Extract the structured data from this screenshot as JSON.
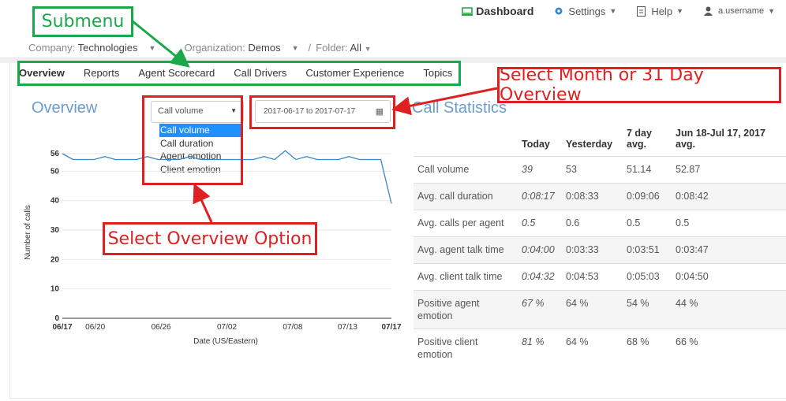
{
  "topnav": {
    "dashboard": "Dashboard",
    "settings": "Settings",
    "help": "Help",
    "user": "a.username"
  },
  "filters": {
    "company_label": "Company:",
    "company_value": "Technologies",
    "org_label": "Organization:",
    "org_value": "Demos",
    "folder_label": "Folder:",
    "folder_value": "All"
  },
  "subnav": {
    "tabs": [
      "Overview",
      "Reports",
      "Agent Scorecard",
      "Call Drivers",
      "Customer Experience",
      "Topics"
    ],
    "active": 0
  },
  "annotations": {
    "submenu": "Submenu",
    "month_overview": "Select Month or 31 Day Overview",
    "overview_option": "Select Overview Option",
    "green": "#1aa84a",
    "red": "#e02020"
  },
  "overview": {
    "title": "Overview",
    "select_value": "Call volume",
    "options": [
      "Call volume",
      "Call duration",
      "Agent emotion",
      "Client emotion"
    ],
    "date_range": "2017-06-17 to 2017-07-17"
  },
  "stats": {
    "title": "Call Statistics",
    "headers": [
      "",
      "Today",
      "Yesterday",
      "7 day avg.",
      "Jun 18-Jul 17, 2017 avg."
    ],
    "rows": [
      [
        "Call volume",
        "39",
        "53",
        "51.14",
        "52.87"
      ],
      [
        "Avg. call duration",
        "0:08:17",
        "0:08:33",
        "0:09:06",
        "0:08:42"
      ],
      [
        "Avg. calls per agent",
        "0.5",
        "0.6",
        "0.5",
        "0.5"
      ],
      [
        "Avg. agent talk time",
        "0:04:00",
        "0:03:33",
        "0:03:51",
        "0:03:47"
      ],
      [
        "Avg. client talk time",
        "0:04:32",
        "0:04:53",
        "0:05:03",
        "0:04:50"
      ],
      [
        "Positive agent emotion",
        "67 %",
        "64 %",
        "54 %",
        "44 %"
      ],
      [
        "Positive client emotion",
        "81 %",
        "64 %",
        "68 %",
        "66 %"
      ]
    ]
  },
  "chart_data": {
    "type": "line",
    "xlabel": "Date (US/Eastern)",
    "ylabel": "Number of calls",
    "x_ticks": [
      "06/17",
      "06/20",
      "06/26",
      "07/02",
      "07/08",
      "07/13",
      "07/17"
    ],
    "y_ticks": [
      0,
      10,
      20,
      30,
      40,
      50,
      56
    ],
    "ylim": [
      0,
      56
    ],
    "color": "#3a87c8",
    "series": [
      {
        "values": [
          56,
          54,
          54,
          54,
          55,
          54,
          54,
          54,
          55,
          54,
          54,
          54,
          55,
          54,
          54,
          54,
          54,
          54,
          54,
          55,
          54,
          57,
          54,
          55,
          54,
          54,
          54,
          55,
          54,
          54,
          54,
          39
        ]
      }
    ]
  }
}
